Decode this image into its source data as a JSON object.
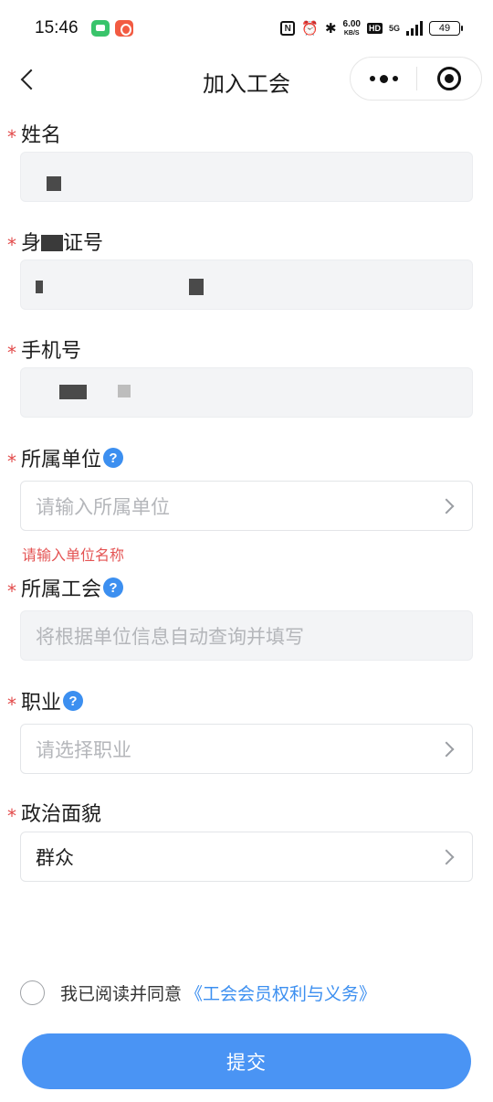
{
  "status_bar": {
    "time": "15:46",
    "nfc": "N",
    "speed_value": "6.00",
    "speed_unit": "KB/S",
    "hd": "HD",
    "signal_label": "5G",
    "battery": "49"
  },
  "nav": {
    "title": "加入工会"
  },
  "form": {
    "name": {
      "label": "姓名",
      "value": ""
    },
    "id_number": {
      "label_prefix": "身",
      "label_suffix": "证号",
      "value": ""
    },
    "phone": {
      "label": "手机号",
      "value": ""
    },
    "unit": {
      "label": "所属单位",
      "placeholder": "请输入所属单位",
      "error": "请输入单位名称"
    },
    "union": {
      "label": "所属工会",
      "placeholder": "将根据单位信息自动查询并填写"
    },
    "occupation": {
      "label": "职业",
      "placeholder": "请选择职业"
    },
    "political": {
      "label": "政治面貌",
      "value": "群众"
    }
  },
  "agreement": {
    "text": "我已阅读并同意",
    "link": "《工会会员权利与义务》"
  },
  "submit_label": "提交",
  "colors": {
    "accent": "#4a94f4",
    "required": "#e24a4a",
    "error": "#e45454",
    "link": "#3c8ff0"
  },
  "icons": {
    "back": "back-arrow-icon",
    "more": "more-dots-icon",
    "close": "miniprogram-close-icon",
    "help": "question-icon",
    "chevron": "chevron-right-icon"
  }
}
